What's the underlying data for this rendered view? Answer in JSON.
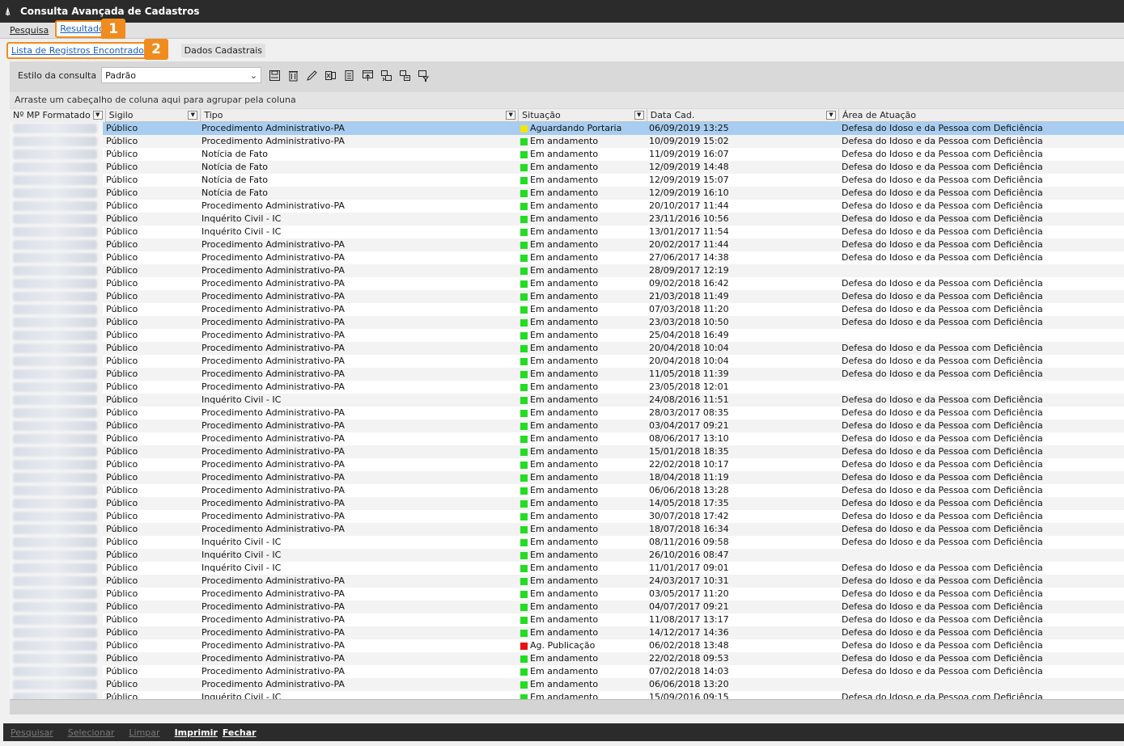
{
  "window": {
    "title": "Consulta Avançada de Cadastros"
  },
  "tabs": [
    {
      "label": "Pesquisa",
      "active": false
    },
    {
      "label": "Resultado",
      "active": true
    }
  ],
  "subtabs": [
    {
      "label": "Lista de Registros Encontrados",
      "active": true
    },
    {
      "label": "Dados Cadastrais",
      "active": false
    }
  ],
  "badges": [
    "1",
    "2"
  ],
  "toolbar": {
    "style_label": "Estilo da consulta",
    "style_value": "Padrão",
    "icons": [
      "save-icon",
      "delete-icon",
      "edit-icon",
      "excel-export-icon",
      "notes-icon",
      "export-up-icon",
      "export-merge-icon",
      "export-list-icon",
      "export-filter-icon"
    ]
  },
  "group_hint": "Arraste um cabeçalho de coluna aqui para agrupar pela coluna",
  "columns": [
    "Nº MP Formatado",
    "Sigilo",
    "Tipo",
    "Situação",
    "Data Cad.",
    "Área de Atuação"
  ],
  "status_colors": {
    "Aguardando Portaria": "#f2e600",
    "Em andamento": "#22dd22",
    "Ag. Publicação": "#e81010"
  },
  "rows": [
    {
      "sigilo": "Público",
      "tipo": "Procedimento Administrativo-PA",
      "situacao": "Aguardando Portaria",
      "data": "06/09/2019 13:25",
      "area": "Defesa do Idoso e da Pessoa com Deficiência"
    },
    {
      "sigilo": "Público",
      "tipo": "Procedimento Administrativo-PA",
      "situacao": "Em andamento",
      "data": "10/09/2019 15:02",
      "area": "Defesa do Idoso e da Pessoa com Deficiência"
    },
    {
      "sigilo": "Público",
      "tipo": "Notícia de Fato",
      "situacao": "Em andamento",
      "data": "11/09/2019 16:07",
      "area": "Defesa do Idoso e da Pessoa com Deficiência"
    },
    {
      "sigilo": "Público",
      "tipo": "Notícia de Fato",
      "situacao": "Em andamento",
      "data": "12/09/2019 14:48",
      "area": "Defesa do Idoso e da Pessoa com Deficiência"
    },
    {
      "sigilo": "Público",
      "tipo": "Notícia de Fato",
      "situacao": "Em andamento",
      "data": "12/09/2019 15:07",
      "area": "Defesa do Idoso e da Pessoa com Deficiência"
    },
    {
      "sigilo": "Público",
      "tipo": "Notícia de Fato",
      "situacao": "Em andamento",
      "data": "12/09/2019 16:10",
      "area": "Defesa do Idoso e da Pessoa com Deficiência"
    },
    {
      "sigilo": "Público",
      "tipo": "Procedimento Administrativo-PA",
      "situacao": "Em andamento",
      "data": "20/10/2017 11:44",
      "area": "Defesa do Idoso e da Pessoa com Deficiência"
    },
    {
      "sigilo": "Público",
      "tipo": "Inquérito Civil - IC",
      "situacao": "Em andamento",
      "data": "23/11/2016 10:56",
      "area": "Defesa do Idoso e da Pessoa com Deficiência"
    },
    {
      "sigilo": "Público",
      "tipo": "Inquérito Civil - IC",
      "situacao": "Em andamento",
      "data": "13/01/2017 11:54",
      "area": "Defesa do Idoso e da Pessoa com Deficiência"
    },
    {
      "sigilo": "Público",
      "tipo": "Procedimento Administrativo-PA",
      "situacao": "Em andamento",
      "data": "20/02/2017 11:44",
      "area": "Defesa do Idoso e da Pessoa com Deficiência"
    },
    {
      "sigilo": "Público",
      "tipo": "Procedimento Administrativo-PA",
      "situacao": "Em andamento",
      "data": "27/06/2017 14:38",
      "area": "Defesa do Idoso e da Pessoa com Deficiência"
    },
    {
      "sigilo": "Público",
      "tipo": "Procedimento Administrativo-PA",
      "situacao": "Em andamento",
      "data": "28/09/2017 12:19",
      "area": ""
    },
    {
      "sigilo": "Público",
      "tipo": "Procedimento Administrativo-PA",
      "situacao": "Em andamento",
      "data": "09/02/2018 16:42",
      "area": "Defesa do Idoso e da Pessoa com Deficiência"
    },
    {
      "sigilo": "Público",
      "tipo": "Procedimento Administrativo-PA",
      "situacao": "Em andamento",
      "data": "21/03/2018 11:49",
      "area": "Defesa do Idoso e da Pessoa com Deficiência"
    },
    {
      "sigilo": "Público",
      "tipo": "Procedimento Administrativo-PA",
      "situacao": "Em andamento",
      "data": "07/03/2018 11:20",
      "area": "Defesa do Idoso e da Pessoa com Deficiência"
    },
    {
      "sigilo": "Público",
      "tipo": "Procedimento Administrativo-PA",
      "situacao": "Em andamento",
      "data": "23/03/2018 10:50",
      "area": "Defesa do Idoso e da Pessoa com Deficiência"
    },
    {
      "sigilo": "Público",
      "tipo": "Procedimento Administrativo-PA",
      "situacao": "Em andamento",
      "data": "25/04/2018 16:49",
      "area": ""
    },
    {
      "sigilo": "Público",
      "tipo": "Procedimento Administrativo-PA",
      "situacao": "Em andamento",
      "data": "20/04/2018 10:04",
      "area": "Defesa do Idoso e da Pessoa com Deficiência"
    },
    {
      "sigilo": "Público",
      "tipo": "Procedimento Administrativo-PA",
      "situacao": "Em andamento",
      "data": "20/04/2018 10:04",
      "area": "Defesa do Idoso e da Pessoa com Deficiência"
    },
    {
      "sigilo": "Público",
      "tipo": "Procedimento Administrativo-PA",
      "situacao": "Em andamento",
      "data": "11/05/2018 11:39",
      "area": "Defesa do Idoso e da Pessoa com Deficiência"
    },
    {
      "sigilo": "Público",
      "tipo": "Procedimento Administrativo-PA",
      "situacao": "Em andamento",
      "data": "23/05/2018 12:01",
      "area": ""
    },
    {
      "sigilo": "Público",
      "tipo": "Inquérito Civil - IC",
      "situacao": "Em andamento",
      "data": "24/08/2016 11:51",
      "area": "Defesa do Idoso e da Pessoa com Deficiência"
    },
    {
      "sigilo": "Público",
      "tipo": "Procedimento Administrativo-PA",
      "situacao": "Em andamento",
      "data": "28/03/2017 08:35",
      "area": "Defesa do Idoso e da Pessoa com Deficiência"
    },
    {
      "sigilo": "Público",
      "tipo": "Procedimento Administrativo-PA",
      "situacao": "Em andamento",
      "data": "03/04/2017 09:21",
      "area": "Defesa do Idoso e da Pessoa com Deficiência"
    },
    {
      "sigilo": "Público",
      "tipo": "Procedimento Administrativo-PA",
      "situacao": "Em andamento",
      "data": "08/06/2017 13:10",
      "area": "Defesa do Idoso e da Pessoa com Deficiência"
    },
    {
      "sigilo": "Público",
      "tipo": "Procedimento Administrativo-PA",
      "situacao": "Em andamento",
      "data": "15/01/2018 18:35",
      "area": "Defesa do Idoso e da Pessoa com Deficiência"
    },
    {
      "sigilo": "Público",
      "tipo": "Procedimento Administrativo-PA",
      "situacao": "Em andamento",
      "data": "22/02/2018 10:17",
      "area": "Defesa do Idoso e da Pessoa com Deficiência"
    },
    {
      "sigilo": "Público",
      "tipo": "Procedimento Administrativo-PA",
      "situacao": "Em andamento",
      "data": "18/04/2018 11:19",
      "area": "Defesa do Idoso e da Pessoa com Deficiência"
    },
    {
      "sigilo": "Público",
      "tipo": "Procedimento Administrativo-PA",
      "situacao": "Em andamento",
      "data": "06/06/2018 13:28",
      "area": "Defesa do Idoso e da Pessoa com Deficiência"
    },
    {
      "sigilo": "Público",
      "tipo": "Procedimento Administrativo-PA",
      "situacao": "Em andamento",
      "data": "14/05/2018 17:35",
      "area": "Defesa do Idoso e da Pessoa com Deficiência"
    },
    {
      "sigilo": "Público",
      "tipo": "Procedimento Administrativo-PA",
      "situacao": "Em andamento",
      "data": "30/07/2018 17:42",
      "area": "Defesa do Idoso e da Pessoa com Deficiência"
    },
    {
      "sigilo": "Público",
      "tipo": "Procedimento Administrativo-PA",
      "situacao": "Em andamento",
      "data": "18/07/2018 16:34",
      "area": "Defesa do Idoso e da Pessoa com Deficiência"
    },
    {
      "sigilo": "Público",
      "tipo": "Inquérito Civil - IC",
      "situacao": "Em andamento",
      "data": "08/11/2016 09:58",
      "area": "Defesa do Idoso e da Pessoa com Deficiência"
    },
    {
      "sigilo": "Público",
      "tipo": "Inquérito Civil - IC",
      "situacao": "Em andamento",
      "data": "26/10/2016 08:47",
      "area": ""
    },
    {
      "sigilo": "Público",
      "tipo": "Inquérito Civil - IC",
      "situacao": "Em andamento",
      "data": "11/01/2017 09:01",
      "area": "Defesa do Idoso e da Pessoa com Deficiência"
    },
    {
      "sigilo": "Público",
      "tipo": "Procedimento Administrativo-PA",
      "situacao": "Em andamento",
      "data": "24/03/2017 10:31",
      "area": "Defesa do Idoso e da Pessoa com Deficiência"
    },
    {
      "sigilo": "Público",
      "tipo": "Procedimento Administrativo-PA",
      "situacao": "Em andamento",
      "data": "03/05/2017 11:20",
      "area": "Defesa do Idoso e da Pessoa com Deficiência"
    },
    {
      "sigilo": "Público",
      "tipo": "Procedimento Administrativo-PA",
      "situacao": "Em andamento",
      "data": "04/07/2017 09:21",
      "area": "Defesa do Idoso e da Pessoa com Deficiência"
    },
    {
      "sigilo": "Público",
      "tipo": "Procedimento Administrativo-PA",
      "situacao": "Em andamento",
      "data": "11/08/2017 13:17",
      "area": "Defesa do Idoso e da Pessoa com Deficiência"
    },
    {
      "sigilo": "Público",
      "tipo": "Procedimento Administrativo-PA",
      "situacao": "Em andamento",
      "data": "14/12/2017 14:36",
      "area": "Defesa do Idoso e da Pessoa com Deficiência"
    },
    {
      "sigilo": "Público",
      "tipo": "Procedimento Administrativo-PA",
      "situacao": "Ag. Publicação",
      "data": "06/02/2018 13:48",
      "area": "Defesa do Idoso e da Pessoa com Deficiência"
    },
    {
      "sigilo": "Público",
      "tipo": "Procedimento Administrativo-PA",
      "situacao": "Em andamento",
      "data": "22/02/2018 09:53",
      "area": "Defesa do Idoso e da Pessoa com Deficiência"
    },
    {
      "sigilo": "Público",
      "tipo": "Procedimento Administrativo-PA",
      "situacao": "Em andamento",
      "data": "07/02/2018 14:03",
      "area": "Defesa do Idoso e da Pessoa com Deficiência"
    },
    {
      "sigilo": "Público",
      "tipo": "Procedimento Administrativo-PA",
      "situacao": "Em andamento",
      "data": "06/06/2018 13:20",
      "area": ""
    },
    {
      "sigilo": "Público",
      "tipo": "Inquérito Civil - IC",
      "situacao": "Em andamento",
      "data": "15/09/2016 09:15",
      "area": "Defesa do Idoso e da Pessoa com Deficiência"
    }
  ],
  "bottom_buttons": [
    {
      "label": "Pesquisar",
      "enabled": false
    },
    {
      "label": "Selecionar",
      "enabled": false
    },
    {
      "label": "Limpar",
      "enabled": false
    },
    {
      "label": "Imprimir",
      "enabled": true
    },
    {
      "label": "Fechar",
      "enabled": true
    }
  ]
}
